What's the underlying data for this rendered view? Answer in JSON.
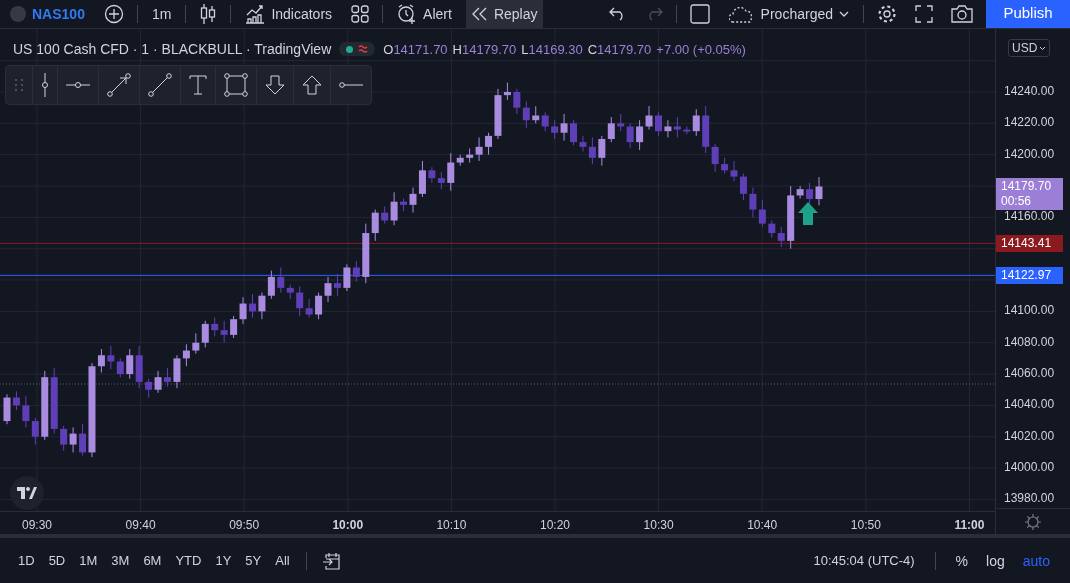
{
  "top_bar": {
    "symbol": "NAS100",
    "interval": "1m",
    "indicators": "Indicators",
    "alert": "Alert",
    "replay": {
      "label": "Replay",
      "on": true
    },
    "undo": {
      "disabled": false
    },
    "redo": {
      "disabled": true
    },
    "layout_name": "Procharged",
    "publish": "Publish"
  },
  "legend": {
    "title": "US 100 Cash CFD",
    "separator": "·",
    "interval": "1",
    "exchange": "BLACKBULL",
    "source": "TradingView",
    "ohlc": [
      {
        "label": "O",
        "value": "14171.70"
      },
      {
        "label": "H",
        "value": "14179.70"
      },
      {
        "label": "L",
        "value": "14169.30"
      },
      {
        "label": "C",
        "value": "14179.70"
      }
    ],
    "change": "+7.00 (+0.05%)"
  },
  "currency": "USD",
  "price_axis": {
    "ticks": [
      "14240.00",
      "14220.00",
      "14200.00",
      "14160.00",
      "14100.00",
      "14080.00",
      "14060.00",
      "14040.00",
      "14020.00",
      "14000.00",
      "13980.00"
    ],
    "markers": [
      {
        "kind": "last",
        "price": "14179.70",
        "countdown": "00:56",
        "color": "#9b7fd6"
      },
      {
        "kind": "line",
        "price": "14143.41",
        "color": "#8b1a1f"
      },
      {
        "kind": "line",
        "price": "14122.97",
        "color": "#2962ff"
      }
    ]
  },
  "time_axis": {
    "ticks": [
      {
        "label": "09:30",
        "bold": false
      },
      {
        "label": "09:40",
        "bold": false
      },
      {
        "label": "09:50",
        "bold": false
      },
      {
        "label": "10:00",
        "bold": true
      },
      {
        "label": "10:10",
        "bold": false
      },
      {
        "label": "10:20",
        "bold": false
      },
      {
        "label": "10:30",
        "bold": false
      },
      {
        "label": "10:40",
        "bold": false
      },
      {
        "label": "10:50",
        "bold": false
      },
      {
        "label": "11:00",
        "bold": true
      }
    ]
  },
  "ranges": [
    "1D",
    "5D",
    "1M",
    "3M",
    "6M",
    "YTD",
    "1Y",
    "5Y",
    "All"
  ],
  "bottom_bar": {
    "clock": "10:45:04 (UTC-4)",
    "scales": [
      {
        "label": "%",
        "on": false
      },
      {
        "label": "log",
        "on": false
      },
      {
        "label": "auto",
        "on": true
      }
    ]
  }
}
